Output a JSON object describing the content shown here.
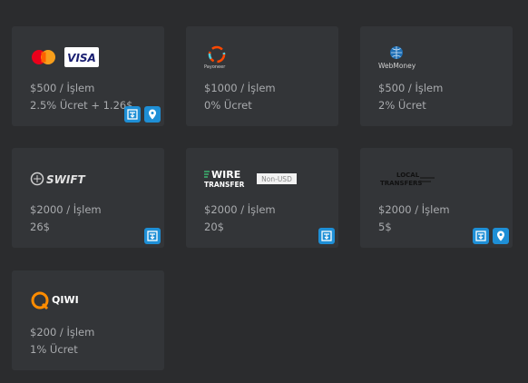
{
  "cards": [
    {
      "logos": [
        "mastercard-logo",
        "visa-logo"
      ],
      "visa_text": "VISA",
      "limit": "$500 / İşlem",
      "fee": "2.5% Ücret + 1.26$",
      "actions": [
        "withdraw-icon",
        "location-pin-icon"
      ]
    },
    {
      "logos": [
        "payoneer-logo"
      ],
      "logo_text": "Payoneer",
      "limit": "$1000 / İşlem",
      "fee": "0% Ücret",
      "actions": []
    },
    {
      "logos": [
        "webmoney-logo"
      ],
      "logo_text": "WebMoney",
      "limit": "$500 / İşlem",
      "fee": "2% Ücret",
      "actions": []
    },
    {
      "logos": [
        "swift-logo"
      ],
      "logo_text": "SWIFT",
      "limit": "$2000 / İşlem",
      "fee": "26$",
      "actions": [
        "withdraw-icon"
      ]
    },
    {
      "logos": [
        "wire-transfer-logo"
      ],
      "logo_text_1": "WIRE",
      "logo_text_2": "TRANSFER",
      "badge": "Non-USD",
      "limit": "$2000 / İşlem",
      "fee": "20$",
      "actions": [
        "withdraw-icon"
      ]
    },
    {
      "logos": [
        "local-transfers-logo"
      ],
      "logo_text_1": "LOCAL",
      "logo_text_2": "TRANSFERS",
      "limit": "$2000 / İşlem",
      "fee": "5$",
      "actions": [
        "withdraw-icon",
        "location-pin-icon"
      ]
    },
    {
      "logos": [
        "qiwi-logo"
      ],
      "logo_text": "QIWI",
      "limit": "$200 / İşlem",
      "fee": "1% Ücret",
      "actions": []
    }
  ],
  "colors": {
    "background": "#2b2c2e",
    "card": "#333538",
    "text": "#a9abae",
    "action": "#1e8fd6"
  }
}
